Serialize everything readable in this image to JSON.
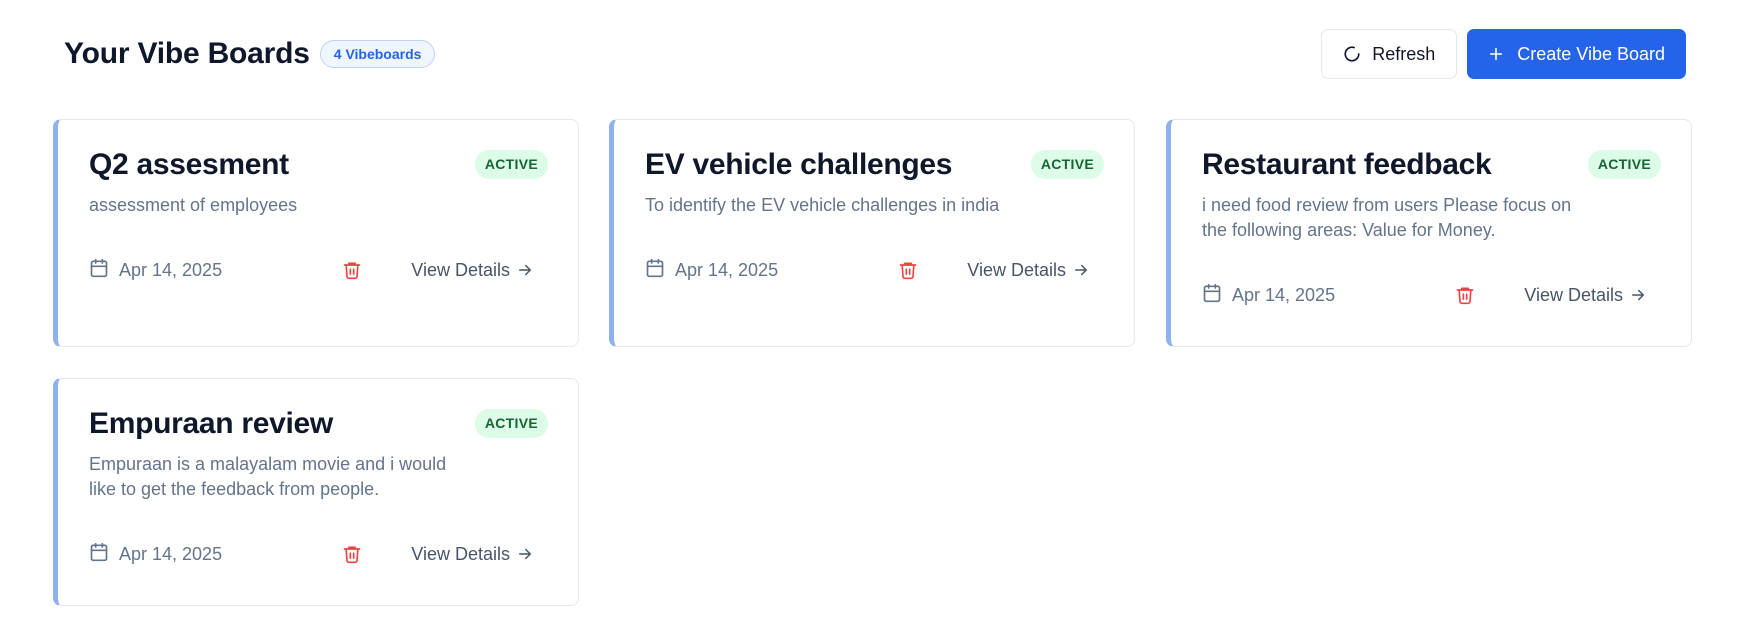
{
  "header": {
    "title": "Your Vibe Boards",
    "count_badge": "4 Vibeboards",
    "refresh_label": "Refresh",
    "create_label": "Create Vibe Board"
  },
  "colors": {
    "primary": "#2563eb",
    "card_accent": "#8fb1ef",
    "active_bg": "#dcfce7",
    "active_text": "#166534",
    "delete": "#ef4444"
  },
  "icons": {
    "refresh": "refresh-icon",
    "create": "plus-icon",
    "date": "calendar-icon",
    "delete": "trash-icon",
    "view": "arrow-right-icon"
  },
  "boards": [
    {
      "title": "Q2 assesment",
      "status": "ACTIVE",
      "description": "assessment of employees",
      "date": "Apr 14, 2025",
      "view_label": "View Details"
    },
    {
      "title": "EV vehicle challenges",
      "status": "ACTIVE",
      "description": "To identify the EV vehicle challenges in india",
      "date": "Apr 14, 2025",
      "view_label": "View Details"
    },
    {
      "title": "Restaurant feedback",
      "status": "ACTIVE",
      "description": "i need food review from users Please focus on the following areas: Value for Money.",
      "date": "Apr 14, 2025",
      "view_label": "View Details"
    },
    {
      "title": "Empuraan review",
      "status": "ACTIVE",
      "description": "Empuraan is a malayalam movie and i would like to get the feedback from people.",
      "date": "Apr 14, 2025",
      "view_label": "View Details"
    }
  ]
}
